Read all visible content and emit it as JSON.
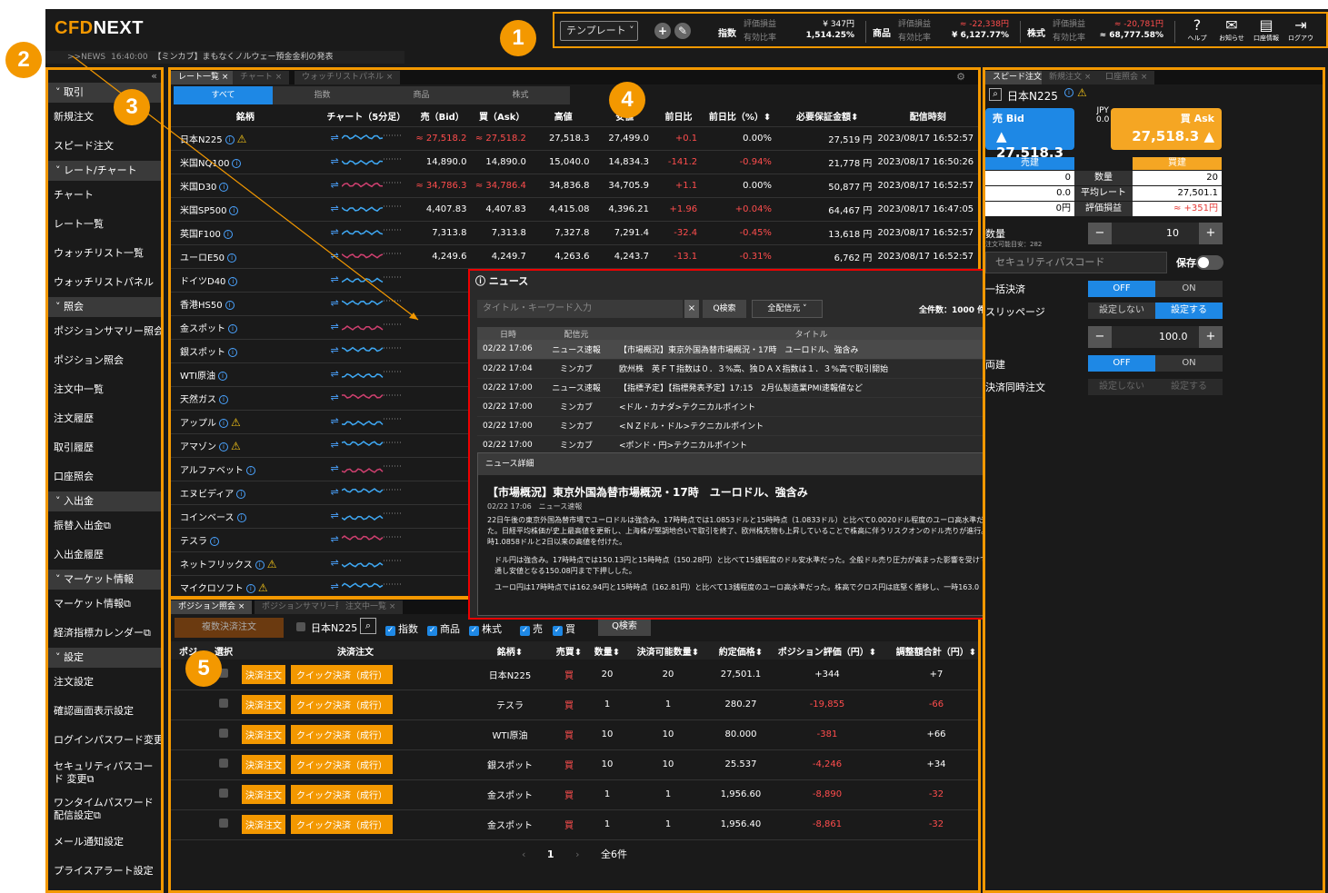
{
  "markers": [
    "1",
    "2",
    "3",
    "4",
    "5"
  ],
  "header": {
    "logo_a": "CFD",
    "logo_b": "NEXT",
    "template_label": "テンプレート ˅",
    "plus": "+",
    "edit": "✎",
    "groups": [
      {
        "key": "指数",
        "l1": "評価損益",
        "l2": "有効比率",
        "v1": "¥ 347円",
        "v2": "1,514.25%",
        "red": false
      },
      {
        "key": "商品",
        "l1": "評価損益",
        "l2": "有効比率",
        "v1": "≈ -22,338円",
        "v2": "¥ 6,127.77%",
        "red": true
      },
      {
        "key": "株式",
        "l1": "評価損益",
        "l2": "有効比率",
        "v1": "≈ -20,781円",
        "v2": "≈ 68,777.58%",
        "red": true
      }
    ],
    "icons": [
      {
        "glyph": "?",
        "label": "ヘルプ"
      },
      {
        "glyph": "✉",
        "label": "お知らせ"
      },
      {
        "glyph": "▤",
        "label": "口座情報"
      },
      {
        "glyph": "⇥",
        "label": "ログアウ"
      }
    ]
  },
  "news_bar": {
    "prefix": ">>NEWS",
    "time": "16:40:00",
    "text": "【ミンカブ】まもなくノルウェー預金金利の発表"
  },
  "sidebar": {
    "sections": [
      {
        "title": "˅ 取引",
        "items": [
          "新規注文",
          "スピード注文"
        ]
      },
      {
        "title": "˅ レート/チャート",
        "items": [
          "チャート",
          "レート一覧",
          "ウォッチリスト一覧",
          "ウォッチリストパネル"
        ]
      },
      {
        "title": "˅ 照会",
        "items": [
          "ポジションサマリー照会",
          "ポジション照会",
          "注文中一覧",
          "注文履歴",
          "取引履歴",
          "口座照会"
        ]
      },
      {
        "title": "˅ 入出金",
        "items": [
          "振替入出金⧉",
          "入出金履歴"
        ]
      },
      {
        "title": "˅ マーケット情報",
        "items": [
          "マーケット情報⧉",
          "経済指標カレンダー⧉"
        ]
      },
      {
        "title": "˅ 設定",
        "items": [
          "注文設定",
          "確認画面表示設定",
          "ログインパスワード変更⧉",
          "セキュリティパスコード 変更⧉",
          "ワンタイムパスワード 配信設定⧉",
          "メール通知設定",
          "プライスアラート設定"
        ]
      }
    ]
  },
  "rate_panel": {
    "tabs": [
      "レート一覧 ×",
      "チャート ×",
      "ウォッチリストパネル ×"
    ],
    "segments": [
      "すべて",
      "指数",
      "商品",
      "株式"
    ],
    "headers": [
      "銘柄",
      "チャート（5分足）",
      "売（Bid）",
      "買（Ask）",
      "高値",
      "安値",
      "前日比",
      "前日比（%）⬍",
      "必要保証金額⬍",
      "配信時刻"
    ],
    "rows": [
      {
        "name": "日本N225",
        "warn": true,
        "bid": "≈ 27,518.2",
        "ask": "≈ 27,518.2",
        "hi": "27,518.3",
        "lo": "27,499.0",
        "chg": "+0.1",
        "pct": "0.00%",
        "req": "27,519 円",
        "time": "2023/08/17 16:52:57",
        "red": true,
        "up": true
      },
      {
        "name": "米国NQ100",
        "warn": false,
        "bid": "14,890.0",
        "ask": "14,890.0",
        "hi": "15,040.0",
        "lo": "14,834.3",
        "chg": "-141.2",
        "pct": "-0.94%",
        "req": "21,778 円",
        "time": "2023/08/17 16:50:26",
        "red": false,
        "up": false
      },
      {
        "name": "米国D30",
        "warn": false,
        "bid": "≈ 34,786.3",
        "ask": "≈ 34,786.4",
        "hi": "34,836.8",
        "lo": "34,705.9",
        "chg": "+1.1",
        "pct": "0.00%",
        "req": "50,877 円",
        "time": "2023/08/17 16:52:57",
        "red": true,
        "up": true
      },
      {
        "name": "米国SP500",
        "warn": false,
        "bid": "4,407.83",
        "ask": "4,407.83",
        "hi": "4,415.08",
        "lo": "4,396.21",
        "chg": "+1.96",
        "pct": "+0.04%",
        "req": "64,467 円",
        "time": "2023/08/17 16:47:05",
        "red": false,
        "up": true
      },
      {
        "name": "英国F100",
        "warn": false,
        "bid": "7,313.8",
        "ask": "7,313.8",
        "hi": "7,327.8",
        "lo": "7,291.4",
        "chg": "-32.4",
        "pct": "-0.45%",
        "req": "13,618 円",
        "time": "2023/08/17 16:52:57",
        "red": false,
        "up": false
      },
      {
        "name": "ユーロE50",
        "warn": false,
        "bid": "4,249.6",
        "ask": "4,249.7",
        "hi": "4,263.6",
        "lo": "4,243.7",
        "chg": "-13.1",
        "pct": "-0.31%",
        "req": "6,762 円",
        "time": "2023/08/17 16:52:57",
        "red": false,
        "up": false
      },
      {
        "name": "ドイツD40",
        "warn": false
      },
      {
        "name": "香港HS50",
        "warn": false
      },
      {
        "name": "金スポット",
        "warn": false
      },
      {
        "name": "銀スポット",
        "warn": false
      },
      {
        "name": "WTI原油",
        "warn": false
      },
      {
        "name": "天然ガス",
        "warn": false
      },
      {
        "name": "アップル",
        "warn": true
      },
      {
        "name": "アマゾン",
        "warn": true
      },
      {
        "name": "アルファベット",
        "warn": false
      },
      {
        "name": "エヌビディア",
        "warn": false
      },
      {
        "name": "コインベース",
        "warn": false
      },
      {
        "name": "テスラ",
        "warn": false
      },
      {
        "name": "ネットフリックス",
        "warn": true
      },
      {
        "name": "マイクロソフト",
        "warn": true
      }
    ]
  },
  "news_window": {
    "title": "ⓘ ニュース",
    "close": "×",
    "search_placeholder": "タイトル・キーワード入力",
    "clear": "×",
    "search_btn": "Q検索",
    "source_sel": "全配信元 ˅",
    "count": "全件数：1000 件",
    "headers": [
      "日時",
      "配信元",
      "タイトル"
    ],
    "rows": [
      {
        "time": "02/22 17:06",
        "src": "ニュース速報",
        "title": "【市場概況】東京外国為替市場概況・17時　ユーロドル、強含み"
      },
      {
        "time": "02/22 17:04",
        "src": "ミンカブ",
        "title": "欧州株　英ＦＴ指数は０．３%高、独ＤＡＸ指数は１．３%高で取引開始"
      },
      {
        "time": "02/22 17:00",
        "src": "ニュース速報",
        "title": "【指標予定】【指標発表予定】17:15　2月仏製造業PMI速報値など"
      },
      {
        "time": "02/22 17:00",
        "src": "ミンカブ",
        "title": "<ドル・カナダ>テクニカルポイント"
      },
      {
        "time": "02/22 17:00",
        "src": "ミンカブ",
        "title": "<ＮＺドル・ドル>テクニカルポイント"
      },
      {
        "time": "02/22 17:00",
        "src": "ミンカブ",
        "title": "<ポンド・円>テクニカルポイント"
      }
    ],
    "detail_label": "ニュース詳細",
    "detail_title": "【市場概況】東京外国為替市場概況・17時　ユーロドル、強含み",
    "detail_meta": "02/22 17:06　ニュース速報",
    "p1": "22日午後の東京外国為替市場でユーロドルは強含み。17時時点では1.0853ドルと15時時点（1.0833ドル）と比べて0.0020ドル程度のユーロ高水準だった。日経平均株価が史上最高値を更新し、上海株が堅調地合いで取引を終了、欧州株先物も上昇していることで株高に伴うリスクオンのドル売りが進行。一時1.0858ドルと2日以来の高値を付けた。",
    "p2": "ドル円は強含み。17時時点では150.13円と15時時点（150.28円）と比べて15銭程度のドル安水準だった。全般ドル売り圧力が高まった影響を受けて日通し安値となる150.08円まで下押しした。",
    "p3": "ユーロ円は17時時点では162.94円と15時時点（162.81円）と比べて13銭程度のユーロ高水準だった。株高でクロス円は底堅く推移し、一時163.0"
  },
  "positions": {
    "tabs": [
      "ポジション照会 ×",
      "ポジションサマリー照会 ×",
      "注文中一覧 ×"
    ],
    "bulk_btn": "複数決済注文",
    "f_name": "日本N225",
    "f_items": [
      "指数",
      "商品",
      "株式",
      "売",
      "買"
    ],
    "search_btn": "Q検索",
    "headers": [
      "ポジ",
      "選択",
      "決済注文",
      "銘柄⬍",
      "売買⬍",
      "数量⬍",
      "決済可能数量⬍",
      "約定価格⬍",
      "ポジション評価（円）⬍",
      "調整額合計（円）⬍",
      "評"
    ],
    "close_btn": "決済注文",
    "quick_btn": "クイック決済（成行）",
    "rows": [
      {
        "name": "日本N225",
        "side": "買",
        "qty": "20",
        "avail": "20",
        "price": "27,501.1",
        "eval": "+344",
        "adj": "+7",
        "eval_neg": false,
        "adj_neg": false
      },
      {
        "name": "テスラ",
        "side": "買",
        "qty": "1",
        "avail": "1",
        "price": "280.27",
        "eval": "-19,855",
        "adj": "-66",
        "eval_neg": true,
        "adj_neg": true
      },
      {
        "name": "WTI原油",
        "side": "買",
        "qty": "10",
        "avail": "10",
        "price": "80.000",
        "eval": "-381",
        "adj": "+66",
        "eval_neg": true,
        "adj_neg": false
      },
      {
        "name": "銀スポット",
        "side": "買",
        "qty": "10",
        "avail": "10",
        "price": "25.537",
        "eval": "-4,246",
        "adj": "+34",
        "eval_neg": true,
        "adj_neg": false
      },
      {
        "name": "金スポット",
        "side": "買",
        "qty": "1",
        "avail": "1",
        "price": "1,956.60",
        "eval": "-8,890",
        "adj": "-32",
        "eval_neg": true,
        "adj_neg": true
      },
      {
        "name": "金スポット",
        "side": "買",
        "qty": "1",
        "avail": "1",
        "price": "1,956.40",
        "eval": "-8,861",
        "adj": "-32",
        "eval_neg": true,
        "adj_neg": true
      }
    ],
    "pager": {
      "prev": "‹",
      "page": "1",
      "next": "›",
      "total": "全6件"
    }
  },
  "speed": {
    "tabs": [
      "スピード注文 ×",
      "新規注文 ×",
      "口座照会 ×"
    ],
    "symbol": "日本N225",
    "ccy": "JPY",
    "spread": "0.0",
    "sell_label": "売 Bid",
    "sell_price": "▲ 27,518.3",
    "buy_label": "買 Ask",
    "buy_price": "27,518.3 ▲",
    "col_sell": "売建",
    "col_buy": "買建",
    "rows": [
      {
        "l": "0",
        "m": "数量",
        "r": "20"
      },
      {
        "l": "0.0",
        "m": "平均レート",
        "r": "27,501.1"
      },
      {
        "l": "0円",
        "m": "評価損益",
        "r": "≈ +351円"
      }
    ],
    "qty_label": "数量",
    "qty_sub": "注文可能目安：282",
    "qty_val": "10",
    "minus": "−",
    "plus": "+",
    "pass_placeholder": "セキュリティパスコード",
    "save": "保存",
    "bulk": "一括決済",
    "slip": "スリッページ",
    "slip_val": "100.0",
    "both": "両建",
    "simul": "決済同時注文",
    "off": "OFF",
    "on": "ON",
    "notset": "設定しない",
    "set": "設定する"
  }
}
